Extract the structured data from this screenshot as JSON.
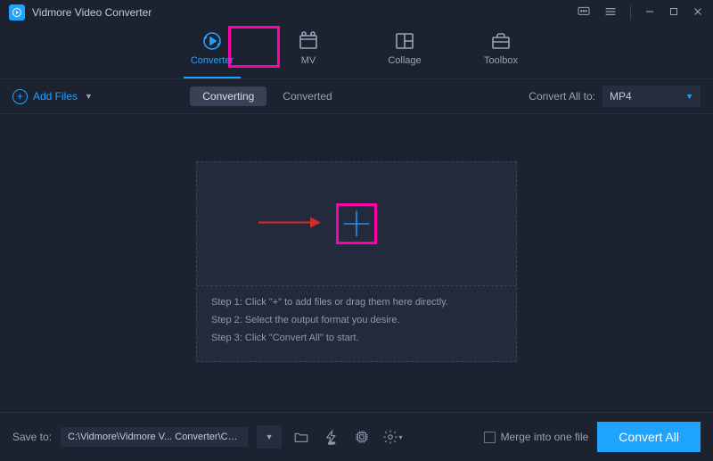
{
  "app": {
    "title": "Vidmore Video Converter"
  },
  "tabs": [
    {
      "label": "Converter",
      "active": true
    },
    {
      "label": "MV"
    },
    {
      "label": "Collage"
    },
    {
      "label": "Toolbox"
    }
  ],
  "toolbar": {
    "add_files": "Add Files",
    "mode_converting": "Converting",
    "mode_converted": "Converted",
    "convert_all_to_label": "Convert All to:",
    "convert_all_to_value": "MP4"
  },
  "dropzone": {
    "step1": "Step 1: Click \"+\" to add files or drag them here directly.",
    "step2": "Step 2: Select the output format you desire.",
    "step3": "Step 3: Click \"Convert All\" to start."
  },
  "footer": {
    "save_to_label": "Save to:",
    "path": "C:\\Vidmore\\Vidmore V... Converter\\Converted",
    "merge_label": "Merge into one file",
    "convert_button": "Convert All"
  }
}
